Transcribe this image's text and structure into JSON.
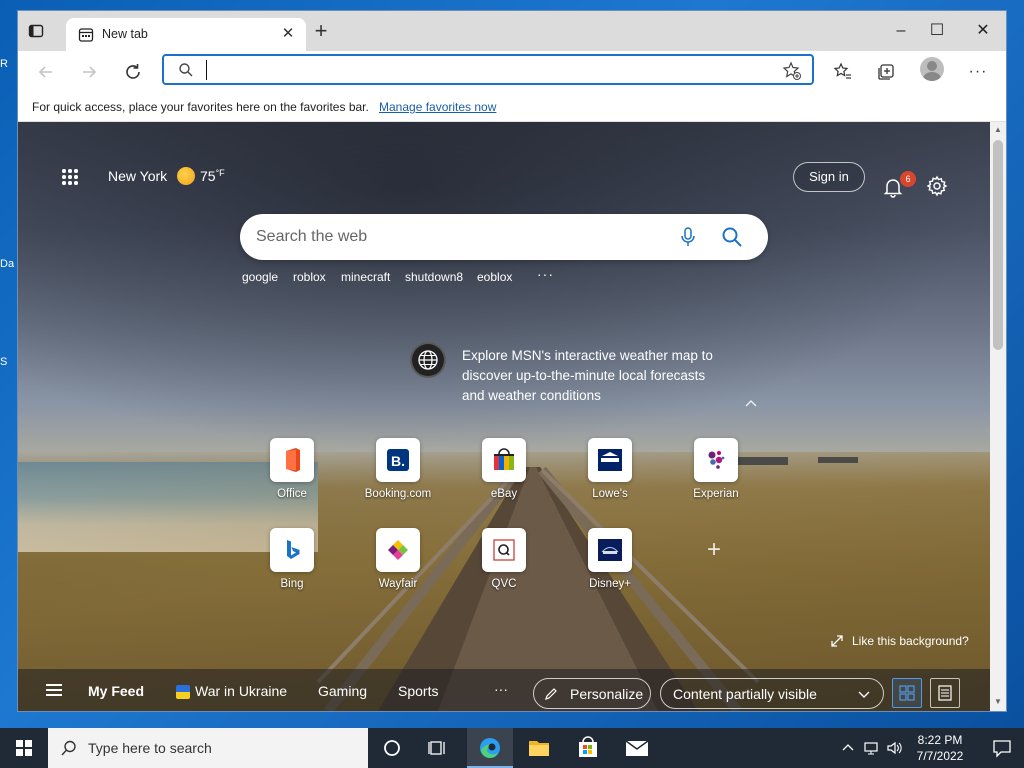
{
  "browser": {
    "tab_title": "New tab",
    "window_controls": {
      "minimize": "–",
      "maximize": "☐",
      "close": "✕"
    },
    "address": {
      "value": "",
      "placeholder": ""
    },
    "favbar_message": "For quick access, place your favorites here on the favorites bar.",
    "favbar_link": "Manage favorites now"
  },
  "newtab": {
    "location": "New York",
    "temperature": "75",
    "temp_unit": "°F",
    "sign_in": "Sign in",
    "notification_count": "6",
    "search_placeholder": "Search the web",
    "trending": [
      "google",
      "roblox",
      "minecraft",
      "shutdown8",
      "eoblox"
    ],
    "trending_more": "···",
    "weather_promo": "Explore MSN's interactive weather map to discover up-to-the-minute local forecasts and weather conditions",
    "sites": [
      {
        "label": "Office",
        "icon": "office-icon"
      },
      {
        "label": "Booking.com",
        "icon": "booking-icon"
      },
      {
        "label": "eBay",
        "icon": "ebay-icon"
      },
      {
        "label": "Lowe's",
        "icon": "lowes-icon"
      },
      {
        "label": "Experian",
        "icon": "experian-icon"
      },
      {
        "label": "Bing",
        "icon": "bing-icon"
      },
      {
        "label": "Wayfair",
        "icon": "wayfair-icon"
      },
      {
        "label": "QVC",
        "icon": "qvc-icon"
      },
      {
        "label": "Disney+",
        "icon": "disney-plus-icon"
      }
    ],
    "like_background": "Like this background?",
    "feed": {
      "my_feed": "My Feed",
      "items": [
        "War in Ukraine",
        "Gaming",
        "Sports"
      ],
      "more": "···",
      "personalize": "Personalize",
      "visibility": "Content partially visible"
    }
  },
  "taskbar": {
    "search_placeholder": "Type here to search",
    "time": "8:22 PM",
    "date": "7/7/2022"
  },
  "colors": {
    "accent": "#1a73c8",
    "badge": "#d9462e",
    "taskbar": "#1f2a36"
  }
}
